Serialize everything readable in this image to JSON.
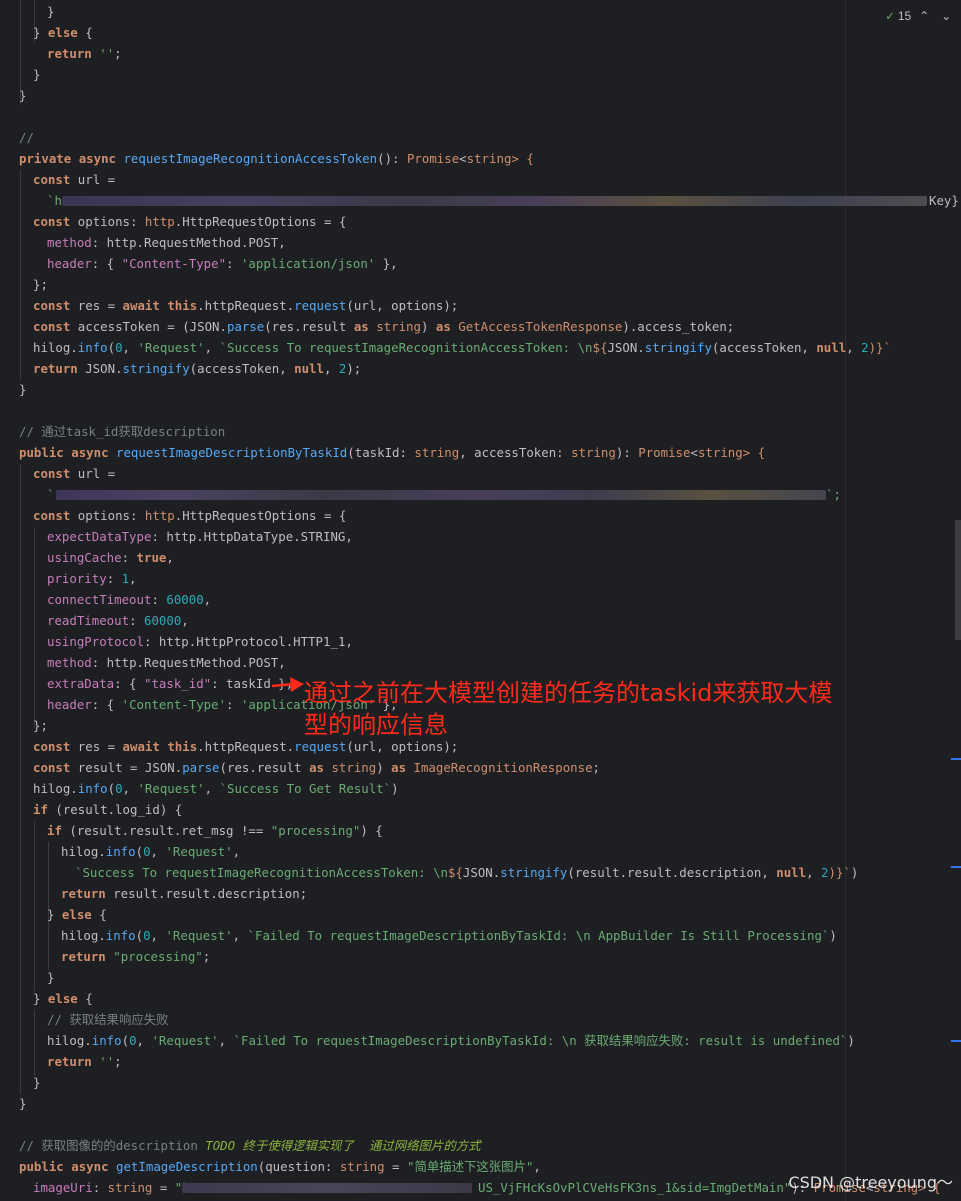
{
  "editor": {
    "inspections_count": "15",
    "watermark": "CSDN @treeyoung～",
    "annotation": "通过之前在大模型创建的任务的taskid来获取大模型的响应信息"
  },
  "code": {
    "l1": "}",
    "l2a": "} ",
    "l2b": "else",
    "l2c": " {",
    "l3a": "return",
    "l3b": " ",
    "l3c": "''",
    "l3d": ";",
    "l4": "}",
    "l5": "}",
    "c1": "//",
    "p1": "private",
    "p2": "async",
    "p3": "requestImageRecognitionAccessToken",
    "p4": "(): ",
    "p5": "Promise",
    "p6": "<",
    "p7": "string",
    "p8": "> {",
    "u1": "const",
    "u2": " url =",
    "u3": "`h",
    "u4": "Key}",
    "o1": "const",
    "o2": " options: ",
    "o3": "http",
    "o4": ".HttpRequestOptions = {",
    "m1": "method",
    "m2": ": http.RequestMethod.POST,",
    "h1": "header",
    "h2": ": { ",
    "h3": "\"Content-Type\"",
    "h4": ": ",
    "h5": "'application/json'",
    "h6": " },",
    "cl1": "};",
    "r1": "const",
    "r2": " res = ",
    "r3": "await",
    "r4": " ",
    "r5": "this",
    "r6": ".httpRequest.",
    "r7": "request",
    "r8": "(url, options);",
    "a1": "const",
    "a2": " accessToken = (JSON.",
    "a3": "parse",
    "a4": "(res.result ",
    "a5": "as",
    "a6": " string",
    "a7": ") ",
    "a8": "as",
    "a9": " GetAccessTokenResponse",
    "a10": ").access_token;",
    "hl1": "hilog.",
    "hl2": "info",
    "hl3": "(",
    "hl4": "0",
    "hl5": ", ",
    "hl6": "'Request'",
    "hl7": ", ",
    "hl8": "`Success To requestImageRecognitionAccessToken: \\n",
    "hl9": "${",
    "hl10": "JSON.",
    "hl11": "stringify",
    "hl12": "(accessToken, ",
    "hl13": "null",
    "hl14": ", ",
    "hl15": "2",
    "hl16": ")}`",
    "rt1": "return",
    "rt2": " JSON.",
    "rt3": "stringify",
    "rt4": "(accessToken, ",
    "rt5": "null",
    "rt6": ", ",
    "rt7": "2",
    "rt8": ");",
    "end1": "}",
    "c2": "// 通过task_id获取description",
    "q1": "public",
    "q2": "async",
    "q3": "requestImageDescriptionByTaskId",
    "q4": "(taskId: ",
    "q5": "string",
    "q6": ", accessToken: ",
    "q7": "string",
    "q8": "): ",
    "q9": "Promise",
    "q10": "<",
    "q11": "string",
    "q12": "> {",
    "v1": "const",
    "v2": " url =",
    "v3": "`",
    "v4": "`;",
    "w1": "const",
    "w2": " options: ",
    "w3": "http",
    "w4": ".HttpRequestOptions = {",
    "e1": "expectDataType",
    "e2": ": http.HttpDataType.STRING,",
    "f1": "usingCache",
    "f2": ": ",
    "f3": "true",
    "f4": ",",
    "g1": "priority",
    "g2": ": ",
    "g3": "1",
    "g4": ",",
    "i1": "connectTimeout",
    "i2": ": ",
    "i3": "60000",
    "i4": ",",
    "j1": "readTimeout",
    "j2": ": ",
    "j3": "60000",
    "j4": ",",
    "k1": "usingProtocol",
    "k2": ": http.HttpProtocol.HTTP1_1,",
    "n1": "method",
    "n2": ": http.RequestMethod.POST,",
    "x1": "extraData",
    "x2": ": { ",
    "x3": "\"task_id\"",
    "x4": ": taskId },",
    "y1": "header",
    "y2": ": { ",
    "y3": "'Content-Type'",
    "y4": ": ",
    "y5": "'application/json'",
    "y6": " },",
    "cl2": "};",
    "s1": "const",
    "s2": " res = ",
    "s3": "await",
    "s4": " ",
    "s5": "this",
    "s6": ".httpRequest.",
    "s7": "request",
    "s8": "(url, options);",
    "t1": "const",
    "t2": " result = JSON.",
    "t3": "parse",
    "t4": "(res.result ",
    "t5": "as",
    "t6": " string",
    "t7": ") ",
    "t8": "as",
    "t9": " ImageRecognitionResponse",
    "t10": ";",
    "z1": "hilog.",
    "z2": "info",
    "z3": "(",
    "z4": "0",
    "z5": ", ",
    "z6": "'Request'",
    "z7": ", ",
    "z8": "`Success To Get Result`",
    "z9": ")",
    "if1": "if",
    "if2": " (result.log_id) {",
    "if3": "if",
    "if4": " (result.result.ret_msg !== ",
    "if5": "\"processing\"",
    "if6": ") {",
    "b1": "hilog.",
    "b2": "info",
    "b3": "(",
    "b4": "0",
    "b5": ", ",
    "b6": "'Request'",
    "b7": ",",
    "b8": "`Success To requestImageRecognitionAccessToken: \\n",
    "b9": "${",
    "b10": "JSON.",
    "b11": "stringify",
    "b12": "(result.result.description, ",
    "b13": "null",
    "b14": ", ",
    "b15": "2",
    "b16": ")}`",
    "b17": ")",
    "rr1": "return",
    "rr2": " result.result.description;",
    "el1": "} ",
    "el2": "else",
    "el3": " {",
    "d1": "hilog.",
    "d2": "info",
    "d3": "(",
    "d4": "0",
    "d5": ", ",
    "d6": "'Request'",
    "d7": ", ",
    "d8": "`Failed To requestImageDescriptionByTaskId: \\n AppBuilder Is Still Processing`",
    "d9": ")",
    "pp1": "return",
    "pp2": " ",
    "pp3": "\"processing\"",
    "pp4": ";",
    "cb1": "}",
    "el4": "} ",
    "el5": "else",
    "el6": " {",
    "c3": "// 获取结果响应失败",
    "ff1": "hilog.",
    "ff2": "info",
    "ff3": "(",
    "ff4": "0",
    "ff5": ", ",
    "ff6": "'Request'",
    "ff7": ", ",
    "ff8": "`Failed To requestImageDescriptionByTaskId: \\n 获取结果响应失败: result is undefined`",
    "ff9": ")",
    "re1": "return",
    "re2": " ",
    "re3": "''",
    "re4": ";",
    "cb2": "}",
    "cb3": "}",
    "c4a": "// 获取图像的的description ",
    "c4b": "TODO 终于使得逻辑实现了  通过网络图片的方式",
    "g1a": "public",
    "g1b": "async",
    "g1c": "getImageDescription",
    "g1d": "(question: ",
    "g1e": "string",
    "g1f": " = ",
    "g1g": "\"简单描述下这张图片\"",
    "g1h": ",",
    "iu1": "imageUri",
    "iu2": ": ",
    "iu3": "string",
    "iu4": " = ",
    "iu5": "\"h",
    "iu6": "US_VjFHcKsOvPlCVeHsFK3ns_1&sid=ImgDetMain\"",
    "iu7": "): ",
    "iu8": "Promise",
    "iu9": "<",
    "iu10": "string",
    "iu11": "> {"
  }
}
